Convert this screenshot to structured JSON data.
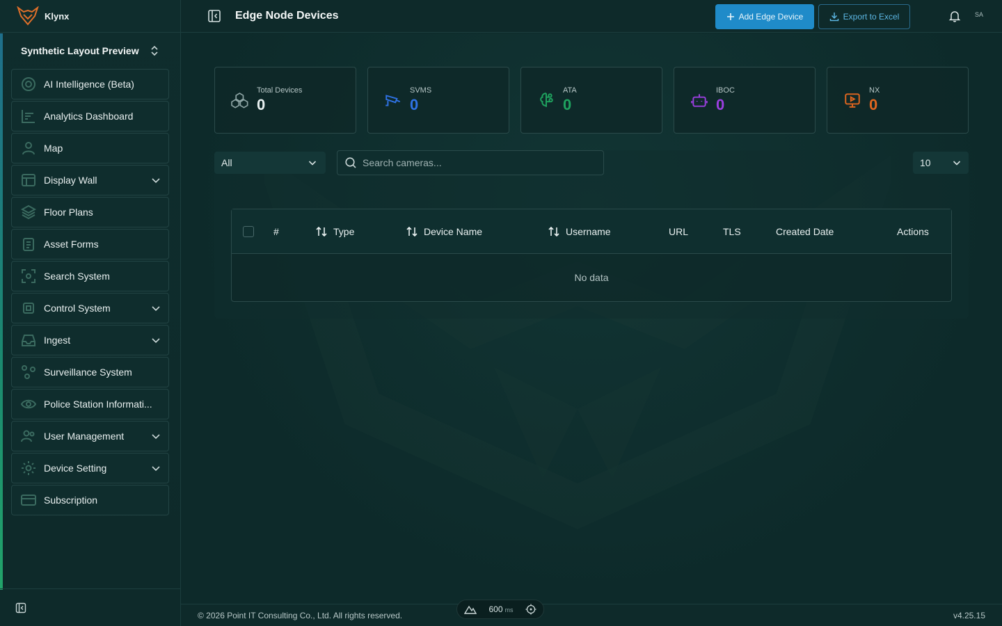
{
  "app": {
    "name": "Klynx",
    "workspace": "Synthetic Layout Preview"
  },
  "header": {
    "title": "Edge Node Devices",
    "add_label": "Add Edge Device",
    "export_label": "Export to Excel",
    "avatar_initials": "SA"
  },
  "sidebar": {
    "items": [
      {
        "label": "AI Intelligence (Beta)",
        "icon": "target-icon",
        "expandable": false
      },
      {
        "label": "Analytics Dashboard",
        "icon": "chart-icon",
        "expandable": false
      },
      {
        "label": "Map",
        "icon": "user-pin-icon",
        "expandable": false
      },
      {
        "label": "Display Wall",
        "icon": "layout-icon",
        "expandable": true
      },
      {
        "label": "Floor Plans",
        "icon": "layers-icon",
        "expandable": false
      },
      {
        "label": "Asset Forms",
        "icon": "clipboard-icon",
        "expandable": false
      },
      {
        "label": "Search System",
        "icon": "scan-icon",
        "expandable": false
      },
      {
        "label": "Control System",
        "icon": "chip-icon",
        "expandable": true
      },
      {
        "label": "Ingest",
        "icon": "tray-icon",
        "expandable": true
      },
      {
        "label": "Surveillance System",
        "icon": "nodes-icon",
        "expandable": false
      },
      {
        "label": "Police Station Informati...",
        "icon": "eye-icon",
        "expandable": false
      },
      {
        "label": "User Management",
        "icon": "users-icon",
        "expandable": true
      },
      {
        "label": "Device Setting",
        "icon": "gear-icon",
        "expandable": true
      },
      {
        "label": "Subscription",
        "icon": "card-icon",
        "expandable": false
      }
    ]
  },
  "stats": [
    {
      "title": "Total Devices",
      "value": "0",
      "color": "#e9f1f1",
      "icon": "cubes-icon"
    },
    {
      "title": "SVMS",
      "value": "0",
      "color": "#2f73e6",
      "icon": "cctv-icon"
    },
    {
      "title": "ATA",
      "value": "0",
      "color": "#1fa35f",
      "icon": "brain-icon"
    },
    {
      "title": "IBOC",
      "value": "0",
      "color": "#9b3fe0",
      "icon": "robot-icon"
    },
    {
      "title": "NX",
      "value": "0",
      "color": "#e0661f",
      "icon": "monitor-play-icon"
    }
  ],
  "filters": {
    "type_selected": "All",
    "search_placeholder": "Search cameras...",
    "page_size": "10"
  },
  "table": {
    "columns": {
      "index": "#",
      "type": "Type",
      "device_name": "Device Name",
      "username": "Username",
      "url": "URL",
      "tls": "TLS",
      "created_date": "Created Date",
      "actions": "Actions"
    },
    "empty_text": "No data"
  },
  "footer": {
    "copyright": "© 2026 Point IT Consulting Co., Ltd. All rights reserved.",
    "version": "v4.25.15",
    "perf_value": "600",
    "perf_unit": "ms"
  }
}
